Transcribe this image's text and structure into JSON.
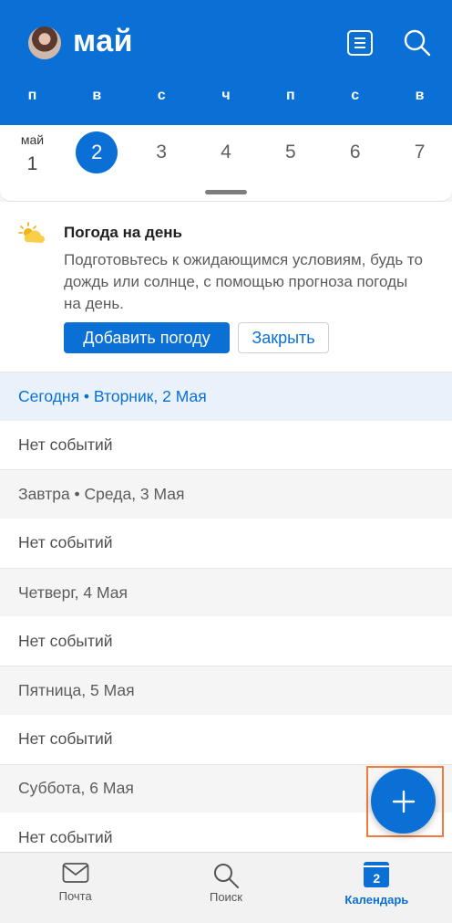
{
  "header": {
    "month_title": "май",
    "weekdays": [
      "п",
      "в",
      "с",
      "ч",
      "п",
      "с",
      "в"
    ]
  },
  "week_strip": {
    "month_label": "май",
    "days": [
      "1",
      "2",
      "3",
      "4",
      "5",
      "6",
      "7"
    ],
    "selected_day": "2"
  },
  "weather_card": {
    "title": "Погода на день",
    "body": "Подготовьтесь к ожидающимся условиям, будь то дождь или солнце, с помощью прогноза погоды на день.",
    "add_button": "Добавить погоду",
    "close_button": "Закрыть"
  },
  "agenda": {
    "rows": [
      {
        "type": "header",
        "today": true,
        "text": "Сегодня • Вторник, 2 Мая"
      },
      {
        "type": "event",
        "text": "Нет событий"
      },
      {
        "type": "header",
        "text": "Завтра • Среда, 3 Мая"
      },
      {
        "type": "event",
        "text": "Нет событий"
      },
      {
        "type": "header",
        "text": "Четверг, 4 Мая"
      },
      {
        "type": "event",
        "text": "Нет событий"
      },
      {
        "type": "header",
        "text": "Пятница, 5 Мая"
      },
      {
        "type": "event",
        "text": "Нет событий"
      },
      {
        "type": "header",
        "text": "Суббота, 6 Мая"
      },
      {
        "type": "event",
        "text": "Нет событий"
      }
    ]
  },
  "bottom_nav": {
    "mail": "Почта",
    "search": "Поиск",
    "calendar": "Календарь",
    "calendar_icon_day": "2"
  },
  "colors": {
    "accent": "#0a70d6",
    "fab_highlight": "#ef7b3f"
  }
}
